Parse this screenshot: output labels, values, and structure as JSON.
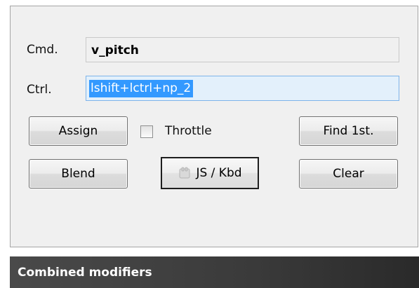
{
  "dialog": {
    "cmd_label": "Cmd.",
    "cmd_value": "v_pitch",
    "ctrl_label": "Ctrl.",
    "ctrl_value": "lshift+lctrl+np_2",
    "assign_label": "Assign",
    "throttle_label": "Throttle",
    "throttle_checked": false,
    "find_label": "Find 1st.",
    "blend_label": "Blend",
    "js_kbd_label": "JS / Kbd",
    "clear_label": "Clear"
  },
  "footer": {
    "caption": "Combined modifiers"
  },
  "icons": {
    "js_kbd": "keyboard-icon"
  }
}
